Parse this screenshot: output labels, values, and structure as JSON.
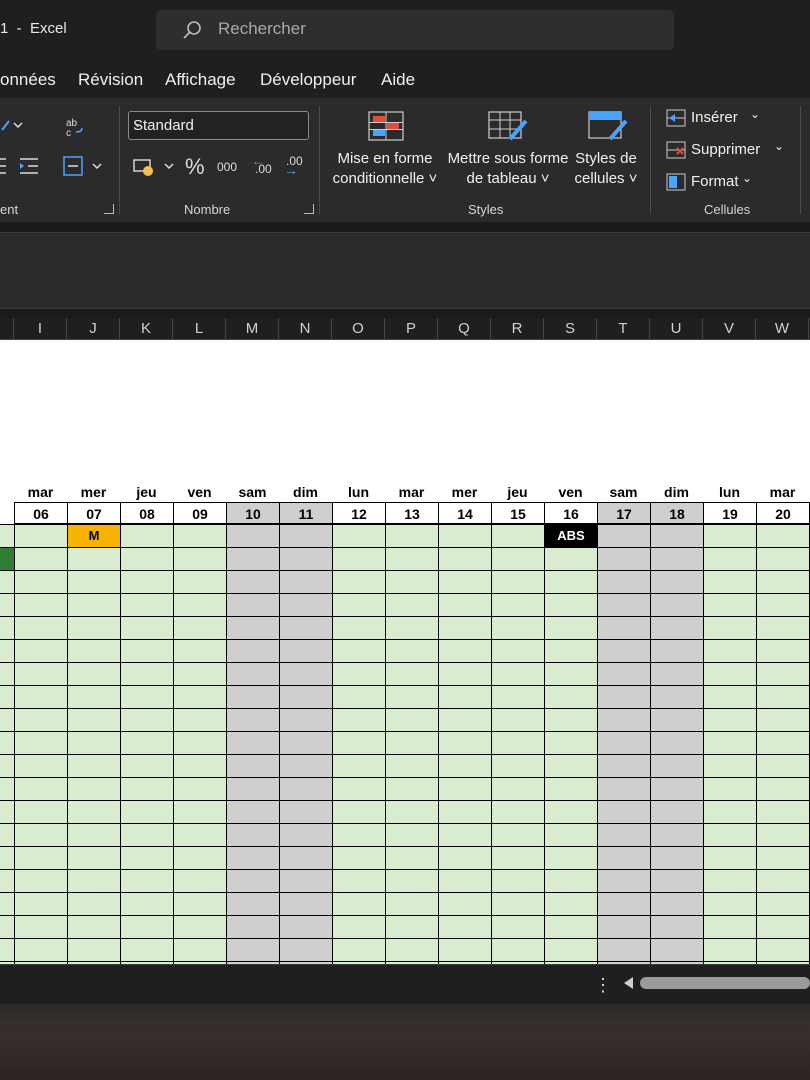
{
  "window": {
    "title": "1  -  Excel"
  },
  "search": {
    "placeholder": "Rechercher"
  },
  "menu": [
    "onnées",
    "Révision",
    "Affichage",
    "Développeur",
    "Aide"
  ],
  "ribbon": {
    "groups": {
      "alignment": "ent",
      "number": "Nombre",
      "styles": "Styles",
      "cells": "Cellules"
    },
    "number_format": "Standard",
    "percent": "%",
    "thousands": "000",
    "dec_inc": ".00",
    "dec_dec": ".00",
    "styles_buttons": [
      {
        "line1": "Mise en forme",
        "line2": "conditionnelle ˅"
      },
      {
        "line1": "Mettre sous forme",
        "line2": "de tableau ˅"
      },
      {
        "line1": "Styles de",
        "line2": "cellules ˅"
      }
    ],
    "cells_buttons": [
      "Insérer",
      "Supprimer",
      "Format"
    ]
  },
  "columns": [
    "I",
    "J",
    "K",
    "L",
    "M",
    "N",
    "O",
    "P",
    "Q",
    "R",
    "S",
    "T",
    "U",
    "V",
    "W"
  ],
  "calendar": {
    "days": [
      "mar",
      "mer",
      "jeu",
      "ven",
      "sam",
      "dim",
      "lun",
      "mar",
      "mer",
      "jeu",
      "ven",
      "sam",
      "dim",
      "lun",
      "mar"
    ],
    "dates": [
      "06",
      "07",
      "08",
      "09",
      "10",
      "11",
      "12",
      "13",
      "14",
      "15",
      "16",
      "17",
      "18",
      "19",
      "20"
    ],
    "weekend_indices": [
      4,
      5,
      11,
      12
    ],
    "badges": [
      {
        "label": "M",
        "col": 1,
        "row": 0,
        "bg": "#f5b300",
        "fg": "#000000"
      },
      {
        "label": "ABS",
        "col": 10,
        "row": 0,
        "bg": "#000000",
        "fg": "#ffffff"
      }
    ],
    "colors": {
      "weekday": "#d9ecd0",
      "weekend": "#cfcfcf",
      "accent": "#2e7d32"
    }
  }
}
